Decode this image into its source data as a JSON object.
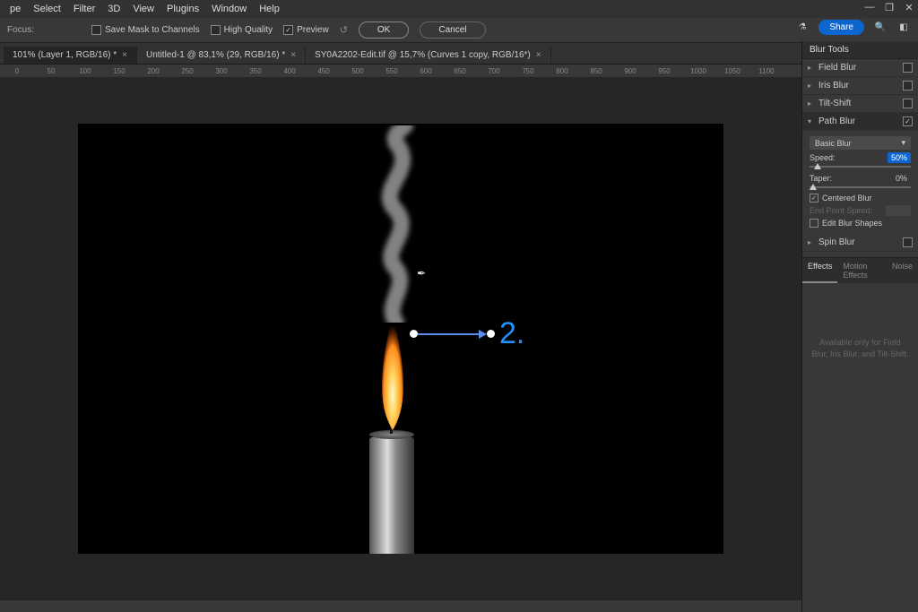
{
  "menu": {
    "items": [
      "pe",
      "Select",
      "Filter",
      "3D",
      "View",
      "Plugins",
      "Window",
      "Help"
    ]
  },
  "window_controls": {
    "min": "—",
    "restore": "❐",
    "close": "✕"
  },
  "options": {
    "focus_label": "Focus:",
    "save_mask": "Save Mask to Channels",
    "high_quality": "High Quality",
    "preview": "Preview",
    "ok": "OK",
    "cancel": "Cancel"
  },
  "topright": {
    "share": "Share"
  },
  "tabs": [
    {
      "label": "101% (Layer 1, RGB/16) *",
      "active": true
    },
    {
      "label": "Untitled-1 @ 83,1% (29, RGB/16) *",
      "active": false
    },
    {
      "label": "SY0A2202-Edit.tif @ 15,7% (Curves 1 copy, RGB/16*)",
      "active": false
    }
  ],
  "ruler": [
    "0",
    "50",
    "100",
    "150",
    "200",
    "250",
    "300",
    "350",
    "400",
    "450",
    "500",
    "550",
    "600",
    "650",
    "700",
    "750",
    "800",
    "850",
    "900",
    "950",
    "1000",
    "1050",
    "1100"
  ],
  "panel": {
    "title": "Blur Tools",
    "tools": [
      {
        "name": "Field Blur",
        "open": false,
        "checked": false
      },
      {
        "name": "Iris Blur",
        "open": false,
        "checked": false
      },
      {
        "name": "Tilt-Shift",
        "open": false,
        "checked": false
      },
      {
        "name": "Path Blur",
        "open": true,
        "checked": true
      },
      {
        "name": "Spin Blur",
        "open": false,
        "checked": false
      }
    ],
    "path_blur": {
      "mode": "Basic Blur",
      "speed_label": "Speed:",
      "speed_val": "50%",
      "taper_label": "Taper:",
      "taper_val": "0%",
      "centered": "Centered Blur",
      "endpoint": "End Point Speed:",
      "edit_shapes": "Edit Blur Shapes"
    },
    "effects_tabs": [
      "Effects",
      "Motion Effects",
      "Noise"
    ],
    "avail_msg": "Available only for Field Blur, Iris Blur, and Tilt-Shift."
  },
  "annotation": "2."
}
